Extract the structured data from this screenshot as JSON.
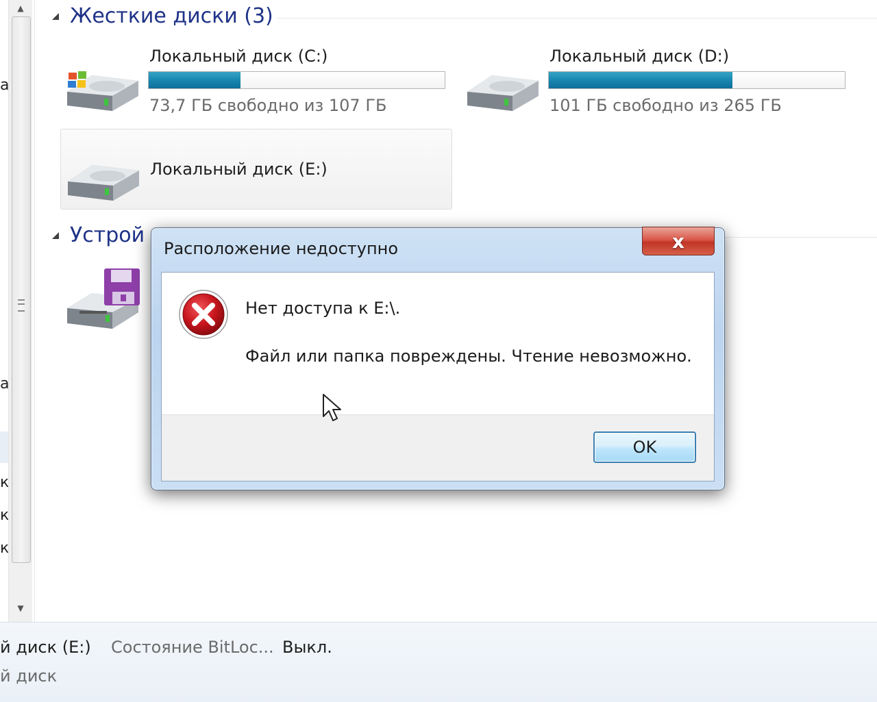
{
  "groups": {
    "hard_drives": {
      "title": "Жесткие диски (3)"
    },
    "devices": {
      "title": "Устрой"
    }
  },
  "drives": [
    {
      "name": "Локальный диск (C:)",
      "free_text": "73,7 ГБ свободно из 107 ГБ",
      "used_fraction": 0.31,
      "icon": "windows-drive-icon"
    },
    {
      "name": "Локальный диск (D:)",
      "free_text": "101 ГБ свободно из 265 ГБ",
      "used_fraction": 0.62,
      "icon": "hard-drive-icon"
    },
    {
      "name": "Локальный диск (E:)",
      "icon": "hard-drive-icon"
    }
  ],
  "nav_fragments": [
    "а",
    "а",
    "к",
    "к",
    "к"
  ],
  "details": {
    "name": "й диск (E:)",
    "bitlocker_label": "Состояние BitLoc...",
    "bitlocker_value": "Выкл.",
    "type": "й диск"
  },
  "dialog": {
    "title": "Расположение недоступно",
    "close_label": "x",
    "message_line1": "Нет доступа к E:\\.",
    "message_line2": "Файл или папка повреждены. Чтение невозможно.",
    "ok_label": "OK"
  },
  "colors": {
    "group_title": "#1e3287",
    "bar_fill": "#1a8ab4",
    "close_button": "#c13526",
    "error_icon": "#c8161d"
  }
}
